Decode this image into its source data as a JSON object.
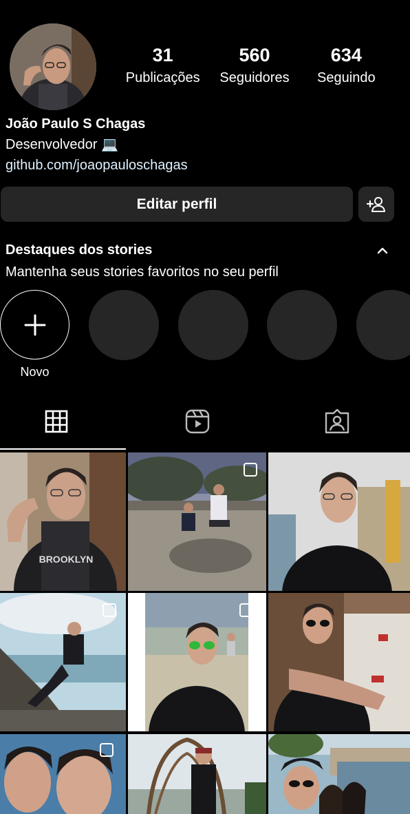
{
  "profile": {
    "name": "João Paulo S Chagas",
    "bio_line": "Desenvolvedor 💻",
    "link": "github.com/joaopauloschagas",
    "avatar_icon": "profile-photo"
  },
  "stats": [
    {
      "value": "31",
      "label": "Publicações"
    },
    {
      "value": "560",
      "label": "Seguidores"
    },
    {
      "value": "634",
      "label": "Seguindo"
    }
  ],
  "actions": {
    "edit_profile_label": "Editar perfil",
    "add_user_icon": "person-plus-icon"
  },
  "highlights": {
    "title": "Destaques dos stories",
    "subtitle": "Mantenha seus stories favoritos no seu perfil",
    "new_label": "Novo",
    "collapse_icon": "chevron-up-icon"
  },
  "tabs": [
    {
      "icon": "grid-icon",
      "selected": true
    },
    {
      "icon": "reels-icon",
      "selected": false
    },
    {
      "icon": "tagged-icon",
      "selected": false
    }
  ],
  "colors": {
    "background": "#000000",
    "button_bg": "#262626",
    "link": "#e0f1ff",
    "text": "#ffffff"
  }
}
